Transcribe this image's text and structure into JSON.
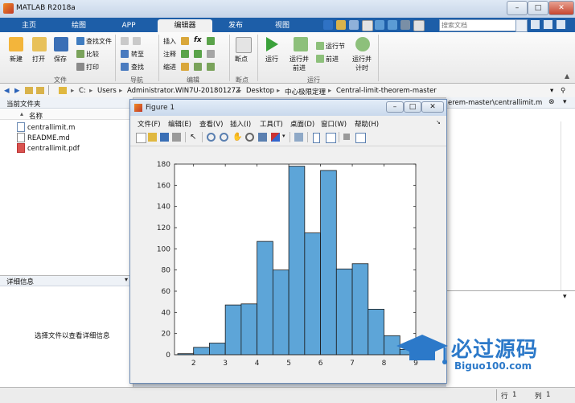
{
  "window": {
    "title": "MATLAB R2018a"
  },
  "ribbon_tabs": [
    "主页",
    "绘图",
    "APP",
    "编辑器",
    "发布",
    "视图"
  ],
  "search": {
    "placeholder": "搜索文档"
  },
  "ribbon": {
    "groups": [
      "文件",
      "导航",
      "编辑",
      "断点",
      "运行"
    ],
    "file": {
      "new": "新建",
      "open": "打开",
      "save": "保存",
      "find_files": "查找文件",
      "compare": "比较",
      "print": "打印"
    },
    "nav": {
      "goto": "转至",
      "find": "查找"
    },
    "edit": {
      "insert": "插入",
      "comment": "注释",
      "indent": "缩进",
      "fx": "fx"
    },
    "breakpoints": {
      "label": "断点"
    },
    "run": {
      "run": "运行",
      "run_advance": "运行并\n前进",
      "run_section": "运行节",
      "advance": "前进",
      "run_time": "运行并\n计时"
    }
  },
  "address": {
    "parts": [
      "C:",
      "Users",
      "Administrator.WIN7U-20180127Z",
      "Desktop",
      "中心极限定理",
      "Central-limit-theorem-master"
    ]
  },
  "current_folder": {
    "title": "当前文件夹",
    "name_header": "名称",
    "files": [
      "centrallimit.m",
      "README.md",
      "centrallimit.pdf"
    ]
  },
  "details": {
    "title": "详细信息",
    "hint": "选择文件以查看详细信息"
  },
  "editor_tab": {
    "label": "erem-master\\centrallimit.m"
  },
  "status": {
    "row_label": "行",
    "row_value": "1",
    "col_label": "列",
    "col_value": "1"
  },
  "figure": {
    "title": "Figure 1",
    "menu": [
      "文件(F)",
      "编辑(E)",
      "查看(V)",
      "插入(I)",
      "工具(T)",
      "桌面(D)",
      "窗口(W)",
      "帮助(H)"
    ]
  },
  "chart_data": {
    "type": "bar",
    "title": "",
    "xlabel": "",
    "ylabel": "",
    "bar_color": "#5da5d8",
    "bin_width": 0.5,
    "bin_starts": [
      1.5,
      2.0,
      2.5,
      3.0,
      3.5,
      4.0,
      4.5,
      5.0,
      5.5,
      6.0,
      6.5,
      7.0,
      7.5,
      8.0,
      8.5
    ],
    "values": [
      1,
      7,
      11,
      47,
      48,
      107,
      80,
      178,
      115,
      174,
      81,
      86,
      43,
      18,
      5
    ],
    "xlim": [
      1.4,
      9.0
    ],
    "ylim": [
      0,
      180
    ],
    "xticks": [
      2,
      3,
      4,
      5,
      6,
      7,
      8,
      9
    ],
    "yticks": [
      0,
      20,
      40,
      60,
      80,
      100,
      120,
      140,
      160,
      180
    ],
    "grid": false
  },
  "watermark": {
    "text": "必过源码",
    "url": "Biguo100.com"
  }
}
